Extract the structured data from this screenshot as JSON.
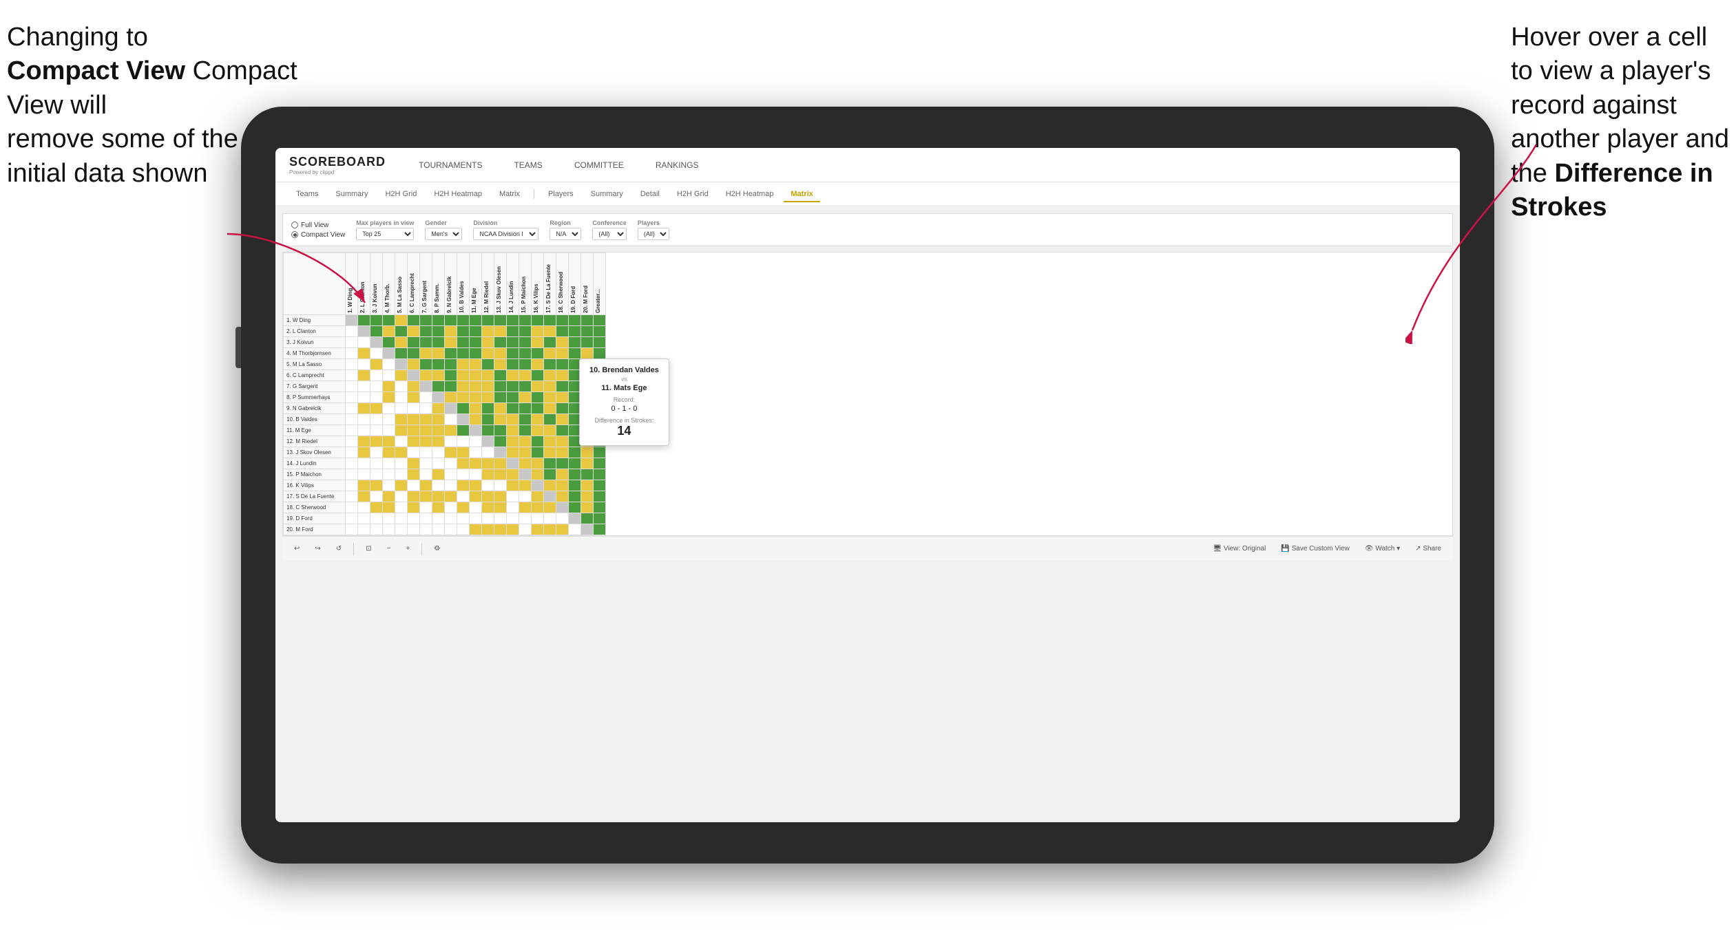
{
  "annotations": {
    "left_line1": "Changing to",
    "left_line2": "Compact View will",
    "left_line3": "remove some of the",
    "left_line4": "initial data shown",
    "right_line1": "Hover over a cell",
    "right_line2": "to view a player's",
    "right_line3": "record against",
    "right_line4": "another player and",
    "right_line5": "the ",
    "right_bold": "Difference in Strokes"
  },
  "nav": {
    "logo": "SCOREBOARD",
    "logo_sub": "Powered by clippd",
    "items": [
      "TOURNAMENTS",
      "TEAMS",
      "COMMITTEE",
      "RANKINGS"
    ]
  },
  "sub_tabs": {
    "group1": [
      "Teams",
      "Summary",
      "H2H Grid",
      "H2H Heatmap",
      "Matrix"
    ],
    "group2": [
      "Players",
      "Summary",
      "Detail",
      "H2H Grid",
      "H2H Heatmap",
      "Matrix"
    ]
  },
  "active_tab": "Matrix",
  "filters": {
    "view_options": [
      "Full View",
      "Compact View"
    ],
    "selected_view": "Compact View",
    "max_players_label": "Max players in view",
    "max_players_value": "Top 25",
    "gender_label": "Gender",
    "gender_value": "Men's",
    "division_label": "Division",
    "division_value": "NCAA Division I",
    "region_label": "Region",
    "region_value": "N/A",
    "conference_label": "Conference",
    "conference_value": "(All)",
    "players_label": "Players",
    "players_value": "(All)"
  },
  "players": [
    "1. W Ding",
    "2. L Clanton",
    "3. J Koivun",
    "4. M Thorbjornsen",
    "5. M La Sasso",
    "6. C Lamprecht",
    "7. G Sargent",
    "8. P Summerhays",
    "9. N Gabrelcik",
    "10. B Valdes",
    "11. M Ege",
    "12. M Riedel",
    "13. J Skov Olesen",
    "14. J Lundin",
    "15. P Maichon",
    "16. K Vilips",
    "17. S De La Fuente",
    "18. C Sherwood",
    "19. D Ford",
    "20. M Ford"
  ],
  "column_headers": [
    "1. W Ding",
    "2. L Clanton",
    "3. J Koivun",
    "4. M Thorb.",
    "5. M La Sasso",
    "6. C Lamprecht",
    "7. G Sargent",
    "8. P Summ.",
    "9. N Gabrelcik",
    "10. B Valdes",
    "11. M Ege",
    "12. M Riedel",
    "13. J Skov Olesen",
    "14. J Lundin",
    "15. P Maichon",
    "16. K Vilips",
    "17. S De La Fuente",
    "18. C Sherwood",
    "19. D Ford",
    "20. M Ford",
    "Greater..."
  ],
  "tooltip": {
    "player1": "10. Brendan Valdes",
    "vs": "vs",
    "player2": "11. Mats Ege",
    "record_label": "Record:",
    "record_value": "0 - 1 - 0",
    "diff_label": "Difference in Strokes:",
    "diff_value": "14"
  },
  "toolbar": {
    "undo": "↩",
    "redo": "↪",
    "zoom_out": "−",
    "zoom_in": "+",
    "fit": "⊡",
    "view_original": "View: Original",
    "save_custom": "Save Custom View",
    "watch": "Watch ▾",
    "share": "Share"
  }
}
